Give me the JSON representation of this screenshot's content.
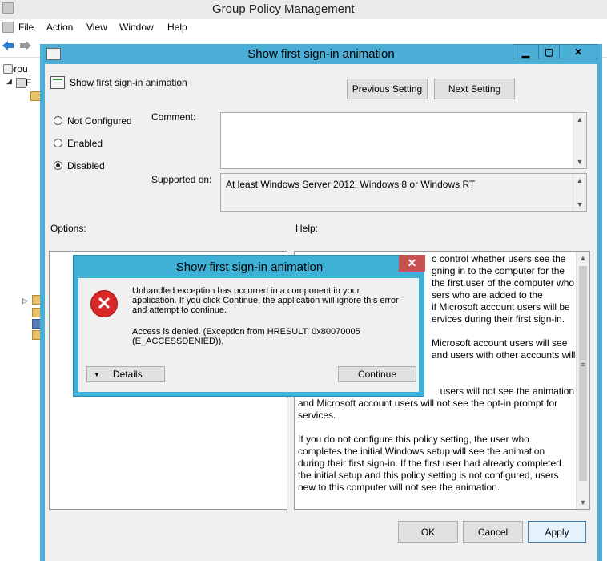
{
  "bg": {
    "title": "Group Policy Management",
    "menu": [
      "File",
      "Action",
      "View",
      "Window",
      "Help"
    ],
    "tree_items": [
      "Grou",
      "F"
    ]
  },
  "dialog": {
    "title": "Show first sign-in animation",
    "setting_name": "Show first sign-in animation",
    "prev_button": "Previous Setting",
    "next_button": "Next Setting",
    "options_state": [
      {
        "label": "Not Configured",
        "selected": false
      },
      {
        "label": "Enabled",
        "selected": false
      },
      {
        "label": "Disabled",
        "selected": true
      }
    ],
    "comment_label": "Comment:",
    "comment_value": "",
    "supported_label": "Supported on:",
    "supported_value": "At least Windows Server 2012, Windows 8 or Windows RT",
    "options_label": "Options:",
    "help_label": "Help:",
    "help_lines_right": [
      "o control whether users see the",
      "gning in to the computer for the",
      "the first user of the computer who",
      "sers who are added to the",
      "if Microsoft account users will be",
      "ervices during their first sign-in.",
      "",
      "Microsoft account users will see",
      "and users with other accounts will"
    ],
    "help_lines_full": [
      ", users will not see the animation",
      "and Microsoft account users will not see the opt-in prompt for",
      "services.",
      "",
      "If you do not configure this policy setting, the user who",
      "completes the initial Windows setup will see the animation",
      "during their first sign-in. If the first user had already completed",
      "the initial setup and this policy setting is not configured, users",
      "new to this computer will not see the animation."
    ],
    "ok_button": "OK",
    "cancel_button": "Cancel",
    "apply_button": "Apply"
  },
  "error": {
    "title": "Show first sign-in animation",
    "message_lines": [
      "Unhandled exception has occurred in a component in your",
      "application. If you click Continue, the application will ignore this error",
      "and attempt to continue."
    ],
    "detail_lines": [
      "Access is denied. (Exception from HRESULT: 0x80070005",
      "(E_ACCESSDENIED))."
    ],
    "details_button": "Details",
    "continue_button": "Continue"
  }
}
